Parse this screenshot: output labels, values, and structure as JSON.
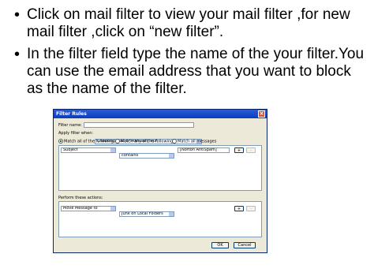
{
  "bullets": [
    {
      "text": "Click on mail filter to view your mail filter ,for new mail filter ,click on “new filter”."
    },
    {
      "text": "In the filter field type the name of the your filter.You can use the email address that you want to block as the name of the filter."
    }
  ],
  "dialog": {
    "title": "Filter Rules",
    "filter_name_label": "Filter name:",
    "filter_name_value": "",
    "apply_label": "Apply filter when:",
    "apply_value": "Checking Mail or Manually Run",
    "match_options": [
      "Match all of the following",
      "Match any of the following",
      "Match all messages"
    ],
    "match_selected": 0,
    "condition": {
      "field": "Subject",
      "operator": "contains",
      "value": "[Norton AntiSpam]"
    },
    "add_label": "+",
    "remove_label": "-",
    "actions_label": "Perform these actions:",
    "action": {
      "type": "Move Message to",
      "target": "Junk on Local Folders"
    },
    "ok_label": "OK",
    "cancel_label": "Cancel"
  }
}
